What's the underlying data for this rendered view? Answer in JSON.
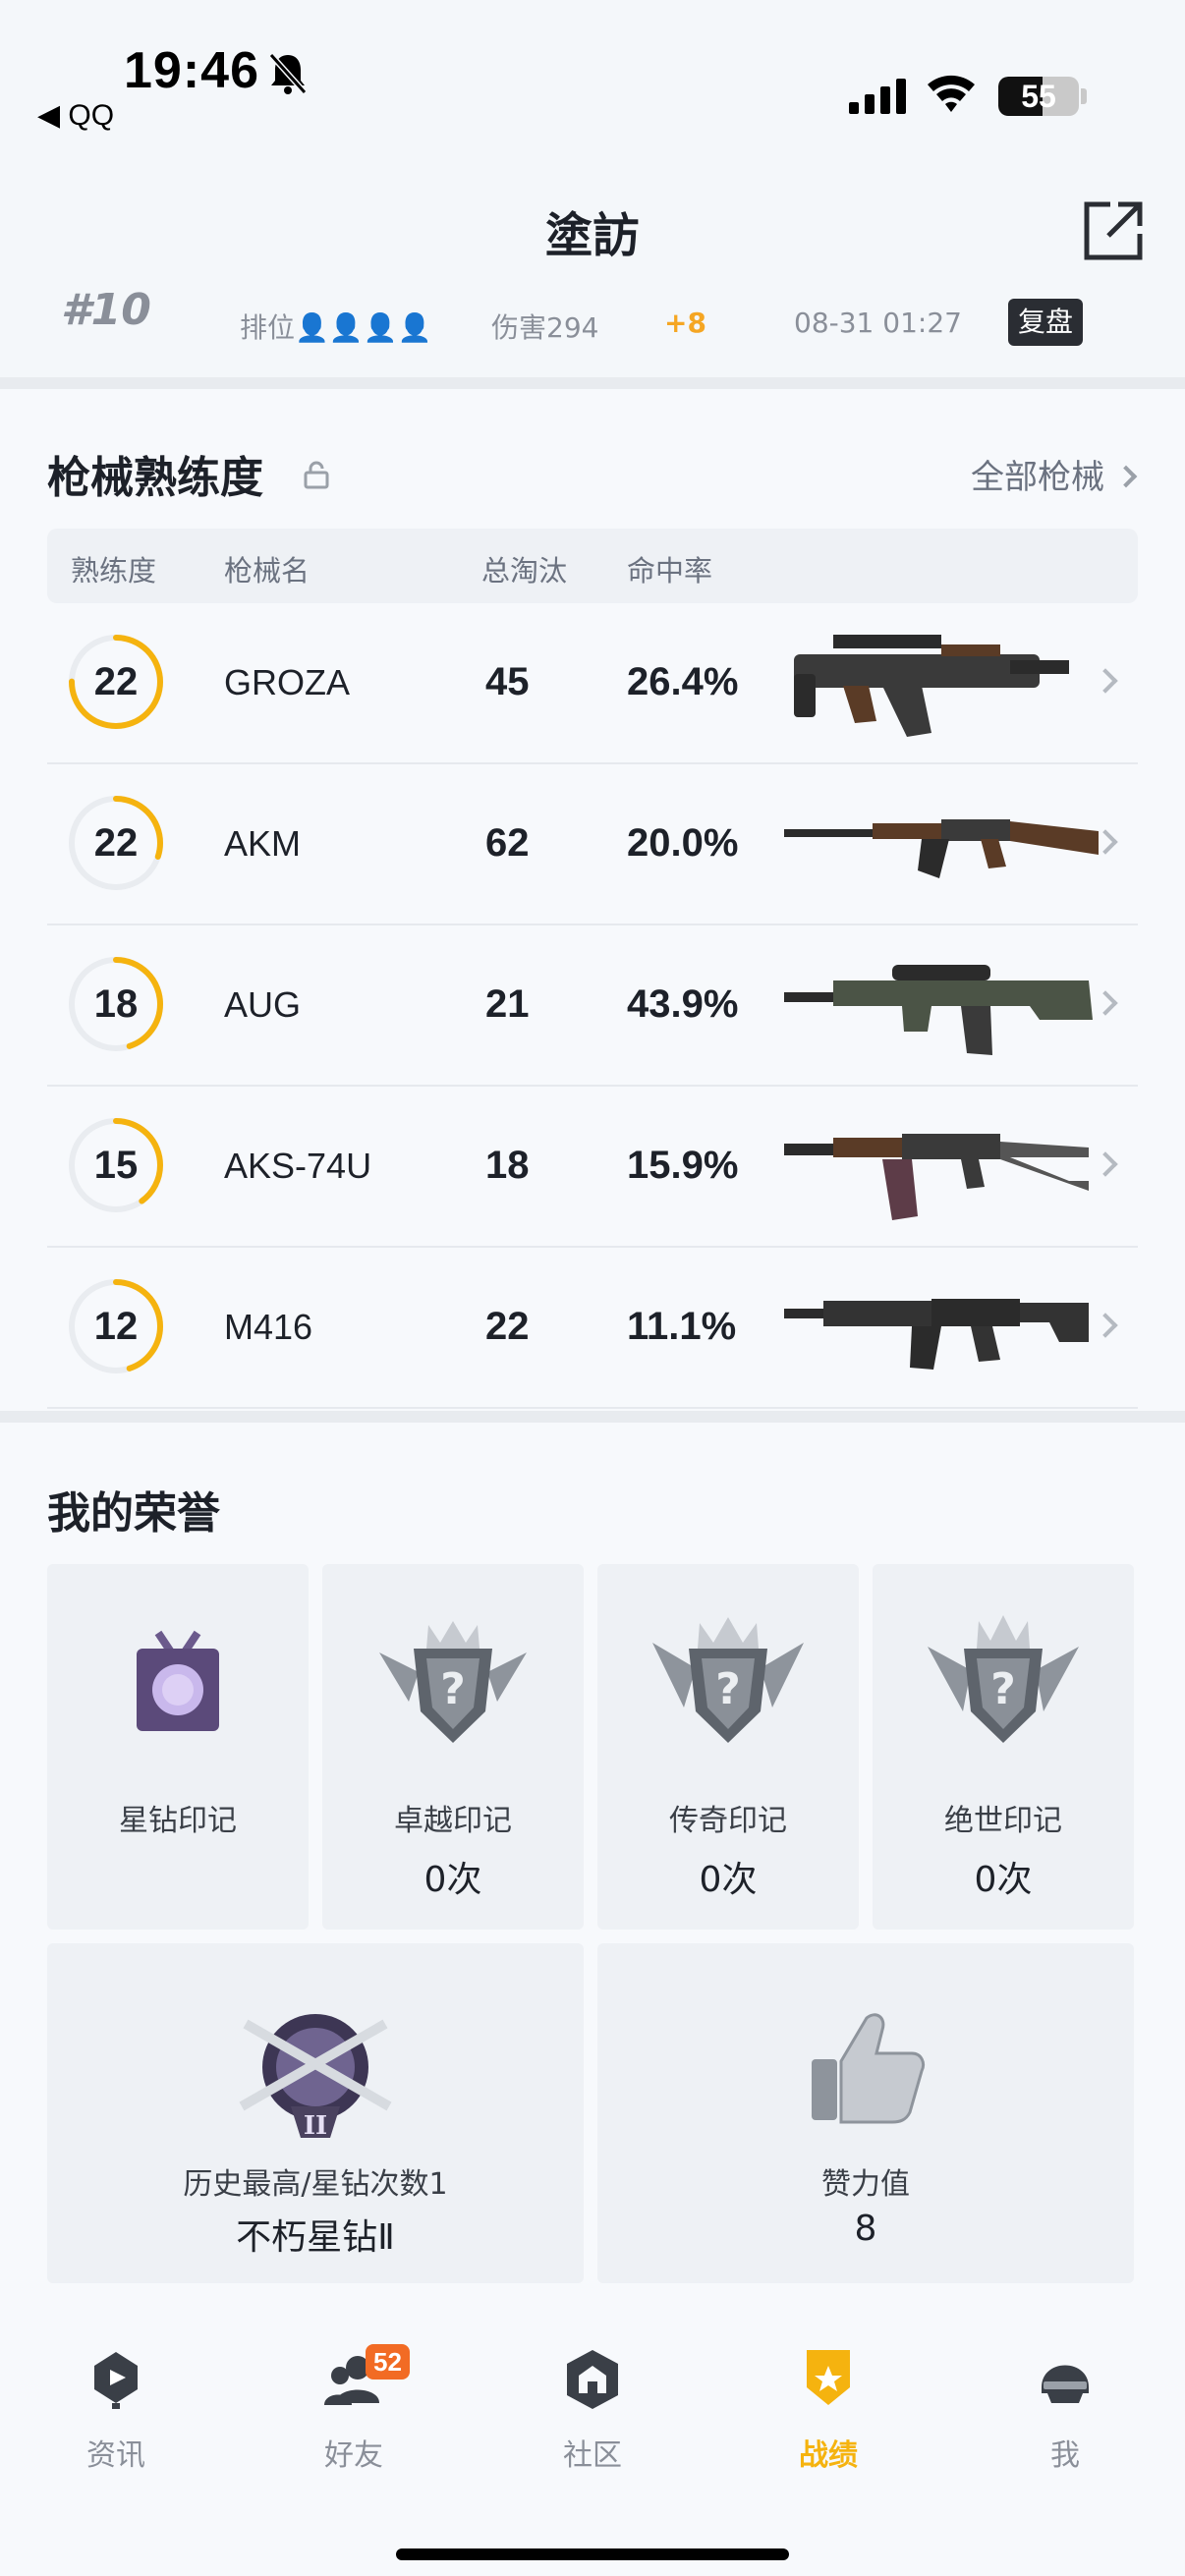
{
  "status_bar": {
    "time": "19:46",
    "back_app": "◀ QQ",
    "battery": "55",
    "battery_level": 0.55
  },
  "header": {
    "title": "塗訪"
  },
  "last_match": {
    "rank": "#10",
    "mode": "排位👤👤👤👤",
    "damage": "伤害294",
    "rank_change": "+8",
    "time": "08-31 01:27",
    "replay": "复盘"
  },
  "weapons": {
    "title": "枪械熟练度",
    "all_link": "全部枪械",
    "columns": [
      "熟练度",
      "枪械名",
      "总淘汰",
      "命中率"
    ],
    "rows": [
      {
        "level": "22",
        "name": "GROZA",
        "kills": "45",
        "accuracy": "26.4%",
        "progress": 0.75,
        "gun": "groza-icon"
      },
      {
        "level": "22",
        "name": "AKM",
        "kills": "62",
        "accuracy": "20.0%",
        "progress": 0.3,
        "gun": "akm-icon"
      },
      {
        "level": "18",
        "name": "AUG",
        "kills": "21",
        "accuracy": "43.9%",
        "progress": 0.45,
        "gun": "aug-icon"
      },
      {
        "level": "15",
        "name": "AKS-74U",
        "kills": "18",
        "accuracy": "15.9%",
        "progress": 0.4,
        "gun": "aks74u-icon"
      },
      {
        "level": "12",
        "name": "M416",
        "kills": "22",
        "accuracy": "11.1%",
        "progress": 0.45,
        "gun": "m416-icon"
      }
    ]
  },
  "honors": {
    "title": "我的荣誉",
    "marks": [
      {
        "label": "星钻印记",
        "count": ""
      },
      {
        "label": "卓越印记",
        "count": "0次"
      },
      {
        "label": "传奇印记",
        "count": "0次"
      },
      {
        "label": "绝世印记",
        "count": "0次"
      }
    ],
    "history": {
      "label": "历史最高/星钻次数1",
      "value": "不朽星钻Ⅱ"
    },
    "likes": {
      "label": "赞力值",
      "value": "8"
    }
  },
  "tabs": [
    {
      "label": "资讯",
      "icon": "news-icon"
    },
    {
      "label": "好友",
      "icon": "friends-icon",
      "badge": "52"
    },
    {
      "label": "社区",
      "icon": "community-icon"
    },
    {
      "label": "战绩",
      "icon": "record-icon",
      "active": true
    },
    {
      "label": "我",
      "icon": "me-icon"
    }
  ],
  "colors": {
    "accent": "#f5b30f",
    "badge": "#f26b24",
    "ring_track": "#e9ecf0"
  }
}
